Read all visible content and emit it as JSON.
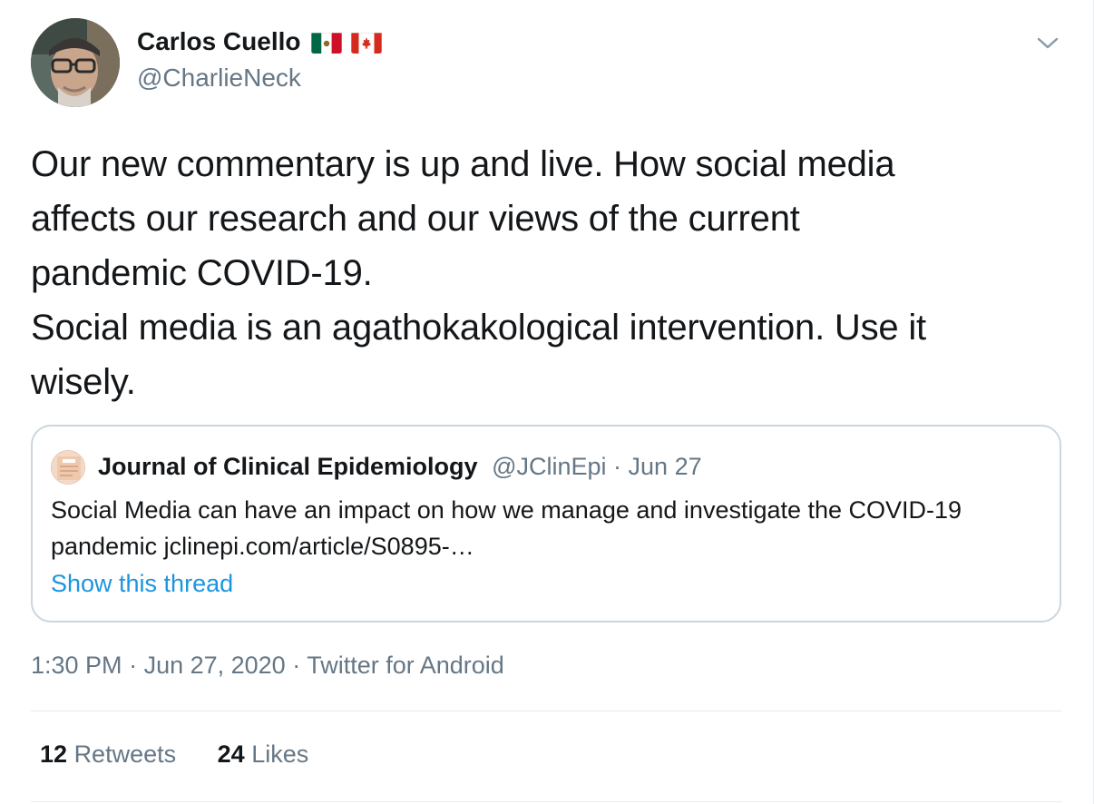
{
  "author": {
    "display_name": "Carlos Cuello",
    "handle": "@CharlieNeck",
    "flags": [
      "flag-mexico-icon",
      "flag-canada-icon"
    ]
  },
  "tweet": {
    "text": "Our new commentary is up and live. How social media\naffects our research and our views of the current\npandemic COVID-19.\nSocial media is an agathokakological intervention. Use it\nwisely."
  },
  "quote": {
    "name": "Journal of Clinical Epidemiology",
    "handle": "@JClinEpi",
    "separator": " · ",
    "date": "Jun 27",
    "text": "Social Media can have an impact on how we manage and investigate the COVID-19 pandemic jclinepi.com/article/S0895-…",
    "show_thread": "Show this thread"
  },
  "meta": {
    "time": "1:30 PM",
    "sep": " · ",
    "date": "Jun 27, 2020",
    "source": "Twitter for Android"
  },
  "stats": {
    "retweets_count": "12",
    "retweets_label": "Retweets",
    "likes_count": "24",
    "likes_label": "Likes"
  },
  "colors": {
    "link": "#1b95e0",
    "secondary_text": "#657786",
    "primary_text": "#14171a",
    "border": "#ccd6dd"
  }
}
